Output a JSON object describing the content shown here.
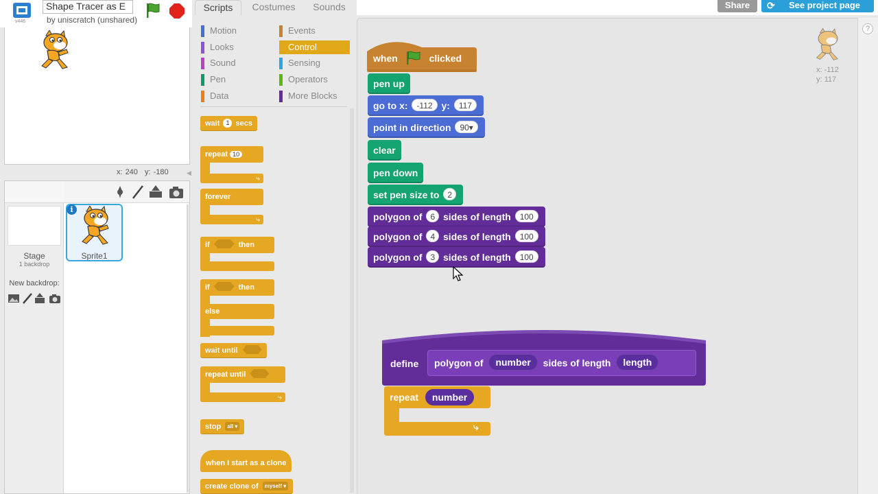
{
  "stage_header": {
    "title": "Shape Tracer as E",
    "byline": "by uniscratch (unshared)",
    "version": "v446"
  },
  "mouse": {
    "x_label": "x:",
    "x": "240",
    "y_label": "y:",
    "y": "-180"
  },
  "sprite_pane": {
    "stage_label": "Stage",
    "backdrop_count": "1 backdrop",
    "new_backdrop": "New backdrop:",
    "sprite_name": "Sprite1",
    "info": "i"
  },
  "tabs": [
    "Scripts",
    "Costumes",
    "Sounds"
  ],
  "categories": [
    {
      "label": "Motion",
      "color": "#4a6cd4"
    },
    {
      "label": "Events",
      "color": "#c88330"
    },
    {
      "label": "Looks",
      "color": "#8a55d7"
    },
    {
      "label": "Control",
      "color": "#e1a91a"
    },
    {
      "label": "Sound",
      "color": "#bb42c3"
    },
    {
      "label": "Sensing",
      "color": "#2ca5e2"
    },
    {
      "label": "Pen",
      "color": "#0e9a6c"
    },
    {
      "label": "Operators",
      "color": "#5cb712"
    },
    {
      "label": "Data",
      "color": "#ee7d16"
    },
    {
      "label": "More Blocks",
      "color": "#632d99"
    }
  ],
  "palette": {
    "wait": "wait",
    "wait_val": "1",
    "secs": "secs",
    "repeat": "repeat",
    "repeat_val": "10",
    "forever": "forever",
    "if": "if",
    "then": "then",
    "if2": "if",
    "then2": "then",
    "else": "else",
    "wait_until": "wait until",
    "repeat_until": "repeat until",
    "stop": "stop",
    "stop_val": "all",
    "clone_start": "when I start as a clone",
    "create_clone": "create clone of",
    "create_clone_val": "myself"
  },
  "topbar": {
    "share": "Share",
    "see_project": "See project page"
  },
  "script": {
    "when": "when",
    "clicked": "clicked",
    "pen_up": "pen up",
    "goto": "go to x:",
    "goto_x": "-112",
    "goto_y_label": "y:",
    "goto_y": "117",
    "point": "point in direction",
    "point_val": "90▾",
    "clear": "clear",
    "pen_down": "pen down",
    "pen_size": "set pen size to",
    "pen_size_val": "2",
    "poly1_a": "polygon of",
    "poly1_n": "6",
    "poly1_b": "sides of length",
    "poly1_len": "100",
    "poly2_a": "polygon of",
    "poly2_n": "4",
    "poly2_b": "sides of length",
    "poly2_len": "100",
    "poly3_a": "polygon of",
    "poly3_n": "3",
    "poly3_b": "sides of length",
    "poly3_len": "100"
  },
  "define": {
    "define": "define",
    "proto_a": "polygon of",
    "param_number": "number",
    "proto_b": "sides of length",
    "param_length": "length",
    "repeat": "repeat",
    "repeat_param": "number"
  },
  "sprite_info": {
    "x": "x: -112",
    "y": "y: 117"
  },
  "help": "?"
}
